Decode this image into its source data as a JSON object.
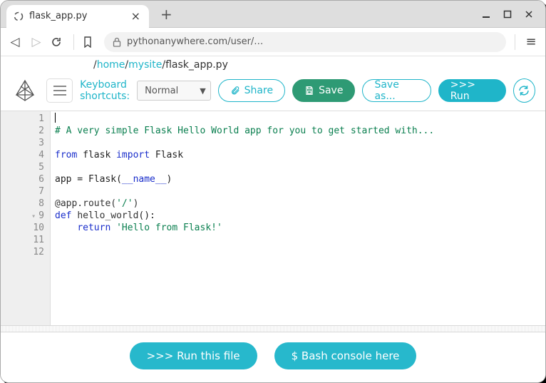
{
  "window": {
    "tab_title": "flask_app.py",
    "url_display": "pythonanywhere.com/user/…"
  },
  "breadcrumbs": {
    "seg1": "home",
    "seg2": "mysite",
    "current": "flask_app.py"
  },
  "toolbar": {
    "kb_line1": "Keyboard",
    "kb_line2": "shortcuts:",
    "mode_options": [
      "Normal"
    ],
    "mode_selected": "Normal",
    "share_label": "Share",
    "save_label": "Save",
    "saveas_label": "Save as...",
    "run_label": ">>> Run"
  },
  "editor": {
    "line_count": 12,
    "fold_lines": [
      9
    ],
    "lines": [
      {
        "n": 1,
        "tokens": [
          {
            "cls": "",
            "t": ""
          }
        ],
        "cursor": true
      },
      {
        "n": 2,
        "tokens": [
          {
            "cls": "tok-comment",
            "t": "# A very simple Flask Hello World app for you to get started with..."
          }
        ]
      },
      {
        "n": 3,
        "tokens": []
      },
      {
        "n": 4,
        "tokens": [
          {
            "cls": "tok-kw",
            "t": "from"
          },
          {
            "cls": "",
            "t": " flask "
          },
          {
            "cls": "tok-kw",
            "t": "import"
          },
          {
            "cls": "",
            "t": " Flask"
          }
        ]
      },
      {
        "n": 5,
        "tokens": []
      },
      {
        "n": 6,
        "tokens": [
          {
            "cls": "",
            "t": "app = Flask("
          },
          {
            "cls": "tok-builtin",
            "t": "__name__"
          },
          {
            "cls": "",
            "t": ")"
          }
        ]
      },
      {
        "n": 7,
        "tokens": []
      },
      {
        "n": 8,
        "tokens": [
          {
            "cls": "tok-dec",
            "t": "@app.route("
          },
          {
            "cls": "tok-str",
            "t": "'/'"
          },
          {
            "cls": "tok-dec",
            "t": ")"
          }
        ]
      },
      {
        "n": 9,
        "tokens": [
          {
            "cls": "tok-kw",
            "t": "def"
          },
          {
            "cls": "",
            "t": " "
          },
          {
            "cls": "tok-func",
            "t": "hello_world"
          },
          {
            "cls": "",
            "t": "():"
          }
        ]
      },
      {
        "n": 10,
        "tokens": [
          {
            "cls": "",
            "t": "    "
          },
          {
            "cls": "tok-kw",
            "t": "return"
          },
          {
            "cls": "",
            "t": " "
          },
          {
            "cls": "tok-str",
            "t": "'Hello from Flask!'"
          }
        ]
      },
      {
        "n": 11,
        "tokens": []
      },
      {
        "n": 12,
        "tokens": []
      }
    ]
  },
  "bottom": {
    "run_file": ">>> Run this file",
    "bash_here": "$ Bash console here"
  }
}
